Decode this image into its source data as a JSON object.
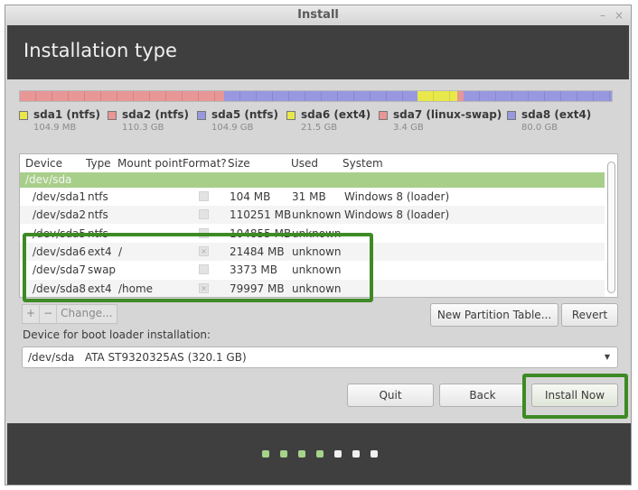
{
  "window": {
    "title": "Install",
    "minimize_label": "–",
    "close_label": "×"
  },
  "header": {
    "title": "Installation type"
  },
  "partition_bar": {
    "segments": [
      {
        "name": "sda1",
        "color": "#e8e84a",
        "fraction": 0.0003
      },
      {
        "name": "sda2",
        "color": "#e89696",
        "fraction": 0.345
      },
      {
        "name": "sda5",
        "color": "#9898e0",
        "fraction": 0.328
      },
      {
        "name": "sda6",
        "color": "#e8e84a",
        "fraction": 0.067
      },
      {
        "name": "sda7",
        "color": "#e89696",
        "fraction": 0.011
      },
      {
        "name": "sda8",
        "color": "#9898e0",
        "fraction": 0.25
      }
    ]
  },
  "legend": [
    {
      "label": "sda1 (ntfs)",
      "size": "104.9 MB",
      "color": "#e8e84a"
    },
    {
      "label": "sda2 (ntfs)",
      "size": "110.3 GB",
      "color": "#e89696"
    },
    {
      "label": "sda5 (ntfs)",
      "size": "104.9 GB",
      "color": "#9898e0"
    },
    {
      "label": "sda6 (ext4)",
      "size": "21.5 GB",
      "color": "#e8e84a"
    },
    {
      "label": "sda7 (linux-swap)",
      "size": "3.4 GB",
      "color": "#e89696"
    },
    {
      "label": "sda8 (ext4)",
      "size": "80.0 GB",
      "color": "#9898e0"
    }
  ],
  "table": {
    "columns": [
      "Device",
      "Type",
      "Mount point",
      "Format?",
      "Size",
      "Used",
      "System"
    ],
    "disk": "/dev/sda",
    "rows": [
      {
        "device": "/dev/sda1",
        "type": "ntfs",
        "mount": "",
        "format": false,
        "size": "104 MB",
        "used": "31 MB",
        "system": "Windows 8 (loader)"
      },
      {
        "device": "/dev/sda2",
        "type": "ntfs",
        "mount": "",
        "format": false,
        "size": "110251 MB",
        "used": "unknown",
        "system": "Windows 8 (loader)"
      },
      {
        "device": "/dev/sda5",
        "type": "ntfs",
        "mount": "",
        "format": false,
        "size": "104855 MB",
        "used": "unknown",
        "system": ""
      },
      {
        "device": "/dev/sda6",
        "type": "ext4",
        "mount": "/",
        "format": true,
        "size": "21484 MB",
        "used": "unknown",
        "system": ""
      },
      {
        "device": "/dev/sda7",
        "type": "swap",
        "mount": "",
        "format": false,
        "size": "3373 MB",
        "used": "unknown",
        "system": ""
      },
      {
        "device": "/dev/sda8",
        "type": "ext4",
        "mount": "/home",
        "format": true,
        "size": "79997 MB",
        "used": "unknown",
        "system": ""
      }
    ]
  },
  "toolbar": {
    "add": "+",
    "remove": "−",
    "change": "Change..."
  },
  "buttons": {
    "new_partition_table": "New Partition Table...",
    "revert": "Revert",
    "quit": "Quit",
    "back": "Back",
    "install_now": "Install Now"
  },
  "boot_loader": {
    "label": "Device for boot loader installation:",
    "value": "/dev/sda   ATA ST9320325AS (320.1 GB)",
    "arrow": "▼"
  },
  "progress": {
    "total_steps": 7,
    "completed_steps": 4,
    "done_color": "#a6d38a",
    "todo_color": "#f0f0f0"
  },
  "accent_color": "#3e8a25"
}
